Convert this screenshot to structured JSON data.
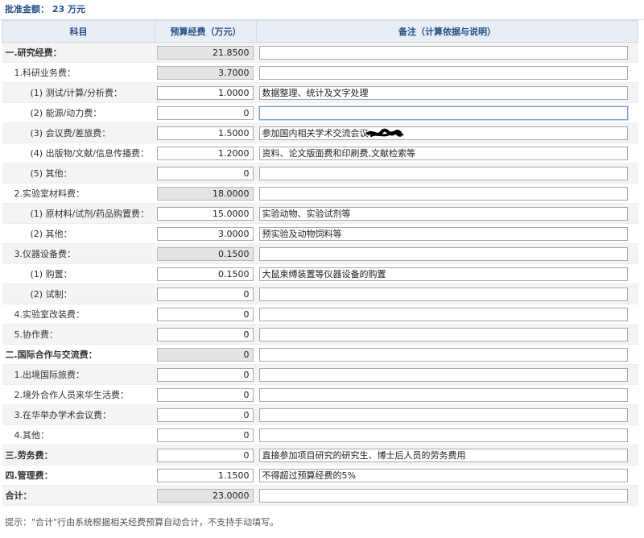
{
  "approved": "批准金额： 23 万元",
  "headers": {
    "subject": "科目",
    "budget": "预算经费（万元）",
    "note": "备注（计算依据与说明）"
  },
  "rows": [
    {
      "label": "一.研究经费：",
      "level": 0,
      "strong": true,
      "amount": "21.8500",
      "readonly": true,
      "note": ""
    },
    {
      "label": "1.科研业务费：",
      "level": 1,
      "amount": "3.7000",
      "readonly": true,
      "note": ""
    },
    {
      "label": "(1) 测试/计算/分析费：",
      "level": 2,
      "amount": "1.0000",
      "note": "数据整理、统计及文字处理"
    },
    {
      "label": "(2) 能源/动力费：",
      "level": 2,
      "amount": "0",
      "note": "",
      "focus": true
    },
    {
      "label": "(3) 会议费/差旅费：",
      "level": 2,
      "amount": "1.5000",
      "note": "参加国内相关学术交流会议",
      "scribble": true
    },
    {
      "label": "(4) 出版物/文献/信息传播费：",
      "level": 2,
      "amount": "1.2000",
      "note": "资料、论文版面费和印刷费,文献检索等"
    },
    {
      "label": "(5) 其他：",
      "level": 2,
      "amount": "0",
      "note": ""
    },
    {
      "label": "2.实验室材料费：",
      "level": 1,
      "amount": "18.0000",
      "readonly": true,
      "note": ""
    },
    {
      "label": "(1) 原材料/试剂/药品购置费：",
      "level": 2,
      "amount": "15.0000",
      "note": "实验动物、实验试剂等"
    },
    {
      "label": "(2) 其他：",
      "level": 2,
      "amount": "3.0000",
      "note": "预实验及动物饲料等"
    },
    {
      "label": "3.仪器设备费：",
      "level": 1,
      "amount": "0.1500",
      "readonly": true,
      "note": ""
    },
    {
      "label": "(1) 购置：",
      "level": 2,
      "amount": "0.1500",
      "note": "大鼠束缚装置等仪器设备的购置"
    },
    {
      "label": "(2) 试制：",
      "level": 2,
      "amount": "0",
      "note": ""
    },
    {
      "label": "4.实验室改装费：",
      "level": 1,
      "amount": "0",
      "note": ""
    },
    {
      "label": "5.协作费：",
      "level": 1,
      "amount": "0",
      "note": ""
    },
    {
      "label": "二.国际合作与交流费：",
      "level": 0,
      "strong": true,
      "amount": "0",
      "readonly": true,
      "note": ""
    },
    {
      "label": "1.出境国际旅费：",
      "level": 1,
      "amount": "0",
      "note": ""
    },
    {
      "label": "2.境外合作人员来华生活费：",
      "level": 1,
      "amount": "0",
      "note": ""
    },
    {
      "label": "3.在华举办学术会议费：",
      "level": 1,
      "amount": "0",
      "note": ""
    },
    {
      "label": "4.其他：",
      "level": 1,
      "amount": "0",
      "note": ""
    },
    {
      "label": "三.劳务费：",
      "level": 0,
      "strong": true,
      "amount": "0",
      "note": "直接参加项目研究的研究生、博士后人员的劳务费用"
    },
    {
      "label": "四.管理费：",
      "level": 0,
      "strong": true,
      "amount": "1.1500",
      "note": "不得超过预算经费的5%"
    },
    {
      "label": "合计：",
      "level": 0,
      "strong": true,
      "amount": "23.0000",
      "readonly": true,
      "note": ""
    }
  ],
  "hint": "提示：\"合计\"行由系统根据相关经费预算自动合计，不支持手动填写。"
}
